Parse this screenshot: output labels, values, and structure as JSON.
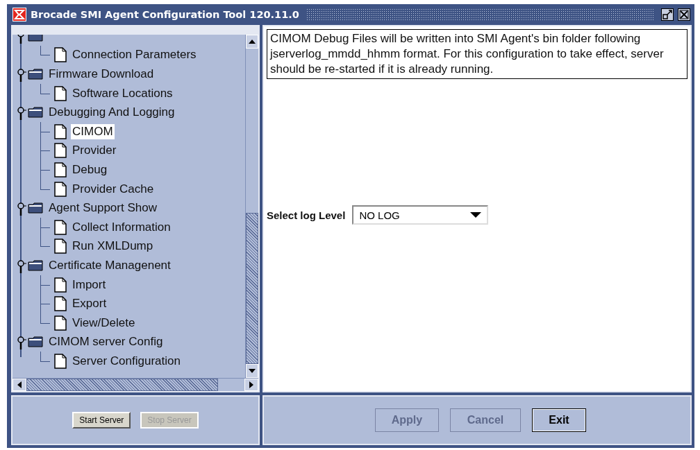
{
  "window": {
    "title": "Brocade SMI Agent Configuration Tool 120.11.0"
  },
  "tree": [
    {
      "expanded": true,
      "children": [
        {
          "label": "Connection Parameters",
          "selected": false
        }
      ]
    },
    {
      "label": "Firmware Download",
      "expanded": true,
      "children": [
        {
          "label": "Software Locations",
          "selected": false
        }
      ]
    },
    {
      "label": "Debugging And Logging",
      "expanded": true,
      "children": [
        {
          "label": "CIMOM",
          "selected": true
        },
        {
          "label": "Provider",
          "selected": false
        },
        {
          "label": "Debug",
          "selected": false
        },
        {
          "label": "Provider Cache",
          "selected": false
        }
      ]
    },
    {
      "label": "Agent Support Show",
      "expanded": true,
      "children": [
        {
          "label": "Collect Information",
          "selected": false
        },
        {
          "label": "Run XMLDump",
          "selected": false
        }
      ]
    },
    {
      "label": "Certificate Managenent",
      "expanded": true,
      "children": [
        {
          "label": "Import",
          "selected": false
        },
        {
          "label": "Export",
          "selected": false
        },
        {
          "label": "View/Delete",
          "selected": false
        }
      ]
    },
    {
      "label": "CIMOM server Config",
      "expanded": true,
      "children": [
        {
          "label": "Server Configuration",
          "selected": false
        }
      ]
    }
  ],
  "server_buttons": [
    {
      "label": "Start Server",
      "disabled": false
    },
    {
      "label": "Stop Server",
      "disabled": true
    }
  ],
  "description": "CIMOM Debug Files will be written into SMI Agent's bin folder following jserverlog_mmdd_hhmm format. For this configuration to take effect, server should be re-started if it is already running.",
  "log_level": {
    "label": "Select log Level",
    "value": "NO LOG"
  },
  "action_buttons": [
    {
      "label": "Apply",
      "disabled": true
    },
    {
      "label": "Cancel",
      "disabled": true
    },
    {
      "label": "Exit",
      "disabled": false
    }
  ]
}
